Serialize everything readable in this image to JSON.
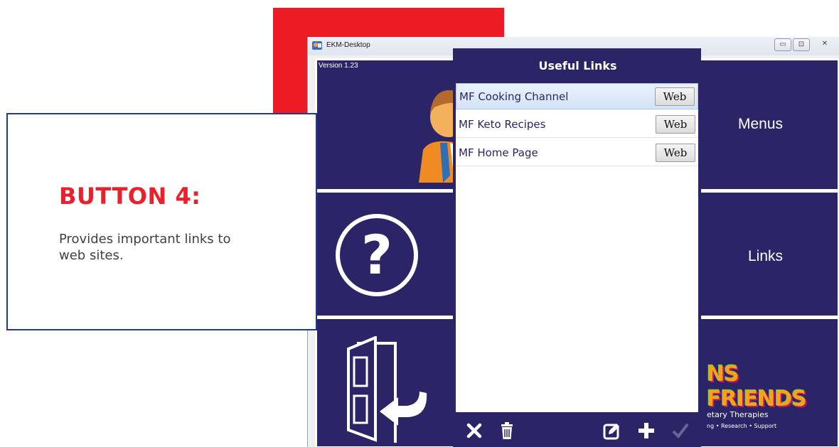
{
  "window": {
    "title": "EKM-Desktop",
    "version": "Version 1.23"
  },
  "tiles": {
    "menus_label": "Menus",
    "links_label": "Links",
    "logo_text": "NS FRIENDS",
    "logo_sub": "etary Therapies",
    "logo_tagline": "ng  •  Research  •  Support"
  },
  "callout": {
    "title": "BUTTON 4:",
    "description": "Provides important links to web sites."
  },
  "dialog": {
    "title": "Useful Links",
    "links": [
      {
        "name": "MF Cooking Channel",
        "button": "Web",
        "selected": true
      },
      {
        "name": "MF Keto Recipes",
        "button": "Web",
        "selected": false
      },
      {
        "name": "MF Home Page",
        "button": "Web",
        "selected": false
      }
    ]
  },
  "icons": {
    "app": "app-icon",
    "user": "user-avatar-icon",
    "help": "question-icon",
    "exit": "exit-door-icon",
    "close": "close-x-icon",
    "delete": "trash-icon",
    "edit": "edit-icon",
    "add": "plus-icon",
    "confirm": "check-icon"
  },
  "colors": {
    "tile": "#2b2567",
    "accent_red": "#ed1c24",
    "callout_border": "#1f3c8a",
    "callout_title": "#e8212c"
  }
}
